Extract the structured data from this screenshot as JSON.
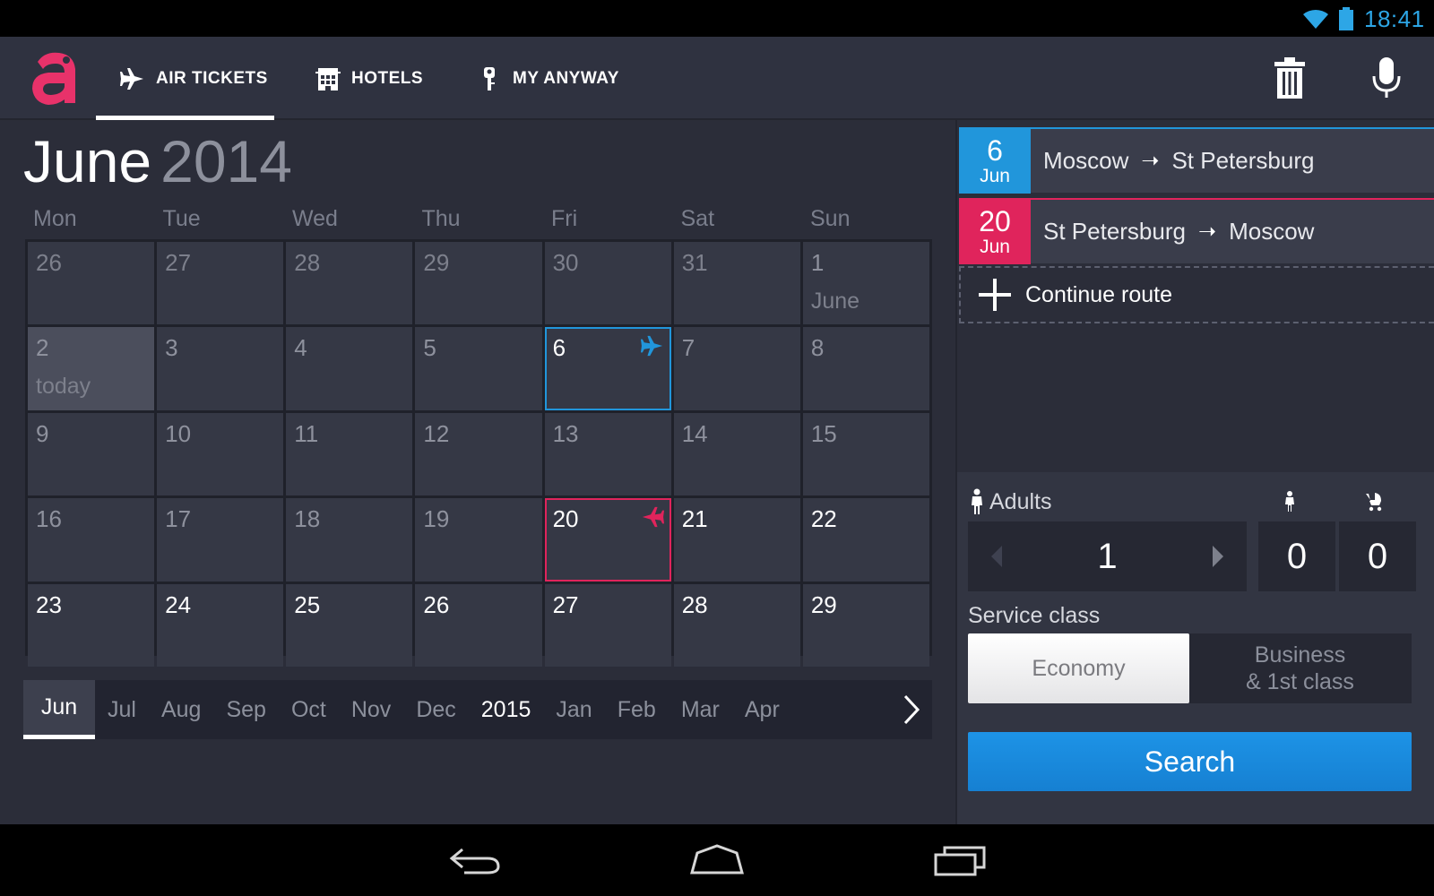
{
  "status_bar": {
    "time": "18:41",
    "icons": [
      "wifi-icon",
      "battery-icon"
    ]
  },
  "action_bar": {
    "logo_letter": "a",
    "tabs": [
      {
        "label": "AIR TICKETS",
        "icon": "plane-icon",
        "active": true
      },
      {
        "label": "HOTELS",
        "icon": "hotel-icon",
        "active": false
      },
      {
        "label": "MY ANYWAY",
        "icon": "key-icon",
        "active": false
      }
    ],
    "actions": [
      "trash-icon",
      "microphone-icon"
    ]
  },
  "calendar": {
    "month": "June",
    "year": "2014",
    "weekdays": [
      "Mon",
      "Tue",
      "Wed",
      "Thu",
      "Fri",
      "Sat",
      "Sun"
    ],
    "weeks": [
      [
        {
          "n": "26"
        },
        {
          "n": "27"
        },
        {
          "n": "28"
        },
        {
          "n": "29"
        },
        {
          "n": "30"
        },
        {
          "n": "31"
        },
        {
          "n": "1",
          "sub": "June"
        }
      ],
      [
        {
          "n": "2",
          "sub": "today"
        },
        {
          "n": "3"
        },
        {
          "n": "4"
        },
        {
          "n": "5"
        },
        {
          "n": "6"
        },
        {
          "n": "7"
        },
        {
          "n": "8"
        }
      ],
      [
        {
          "n": "9"
        },
        {
          "n": "10"
        },
        {
          "n": "11"
        },
        {
          "n": "12"
        },
        {
          "n": "13"
        },
        {
          "n": "14"
        },
        {
          "n": "15"
        }
      ],
      [
        {
          "n": "16"
        },
        {
          "n": "17"
        },
        {
          "n": "18"
        },
        {
          "n": "19"
        },
        {
          "n": "20"
        },
        {
          "n": "21"
        },
        {
          "n": "22"
        }
      ],
      [
        {
          "n": "23"
        },
        {
          "n": "24"
        },
        {
          "n": "25"
        },
        {
          "n": "26"
        },
        {
          "n": "27"
        },
        {
          "n": "28"
        },
        {
          "n": "29"
        }
      ]
    ],
    "month_strip": [
      "Jun",
      "Jul",
      "Aug",
      "Sep",
      "Oct",
      "Nov",
      "Dec",
      "2015",
      "Jan",
      "Feb",
      "Mar",
      "Apr"
    ],
    "active_month": "Jun"
  },
  "routes": [
    {
      "day": "6",
      "month": "Jun",
      "from": "Moscow",
      "to": "St Petersburg",
      "color": "#2196db"
    },
    {
      "day": "20",
      "month": "Jun",
      "from": "St Petersburg",
      "to": "Moscow",
      "color": "#e0245c"
    }
  ],
  "continue_route": "Continue route",
  "passengers": {
    "adults_label": "Adults",
    "adults": "1",
    "children": "0",
    "infants": "0"
  },
  "service_class": {
    "label": "Service class",
    "options": [
      "Economy",
      "Business\n& 1st class"
    ],
    "selected": "Economy"
  },
  "search_label": "Search",
  "colors": {
    "accent_blue": "#2196db",
    "accent_red": "#e0245c",
    "logo_pink": "#e8326a"
  }
}
